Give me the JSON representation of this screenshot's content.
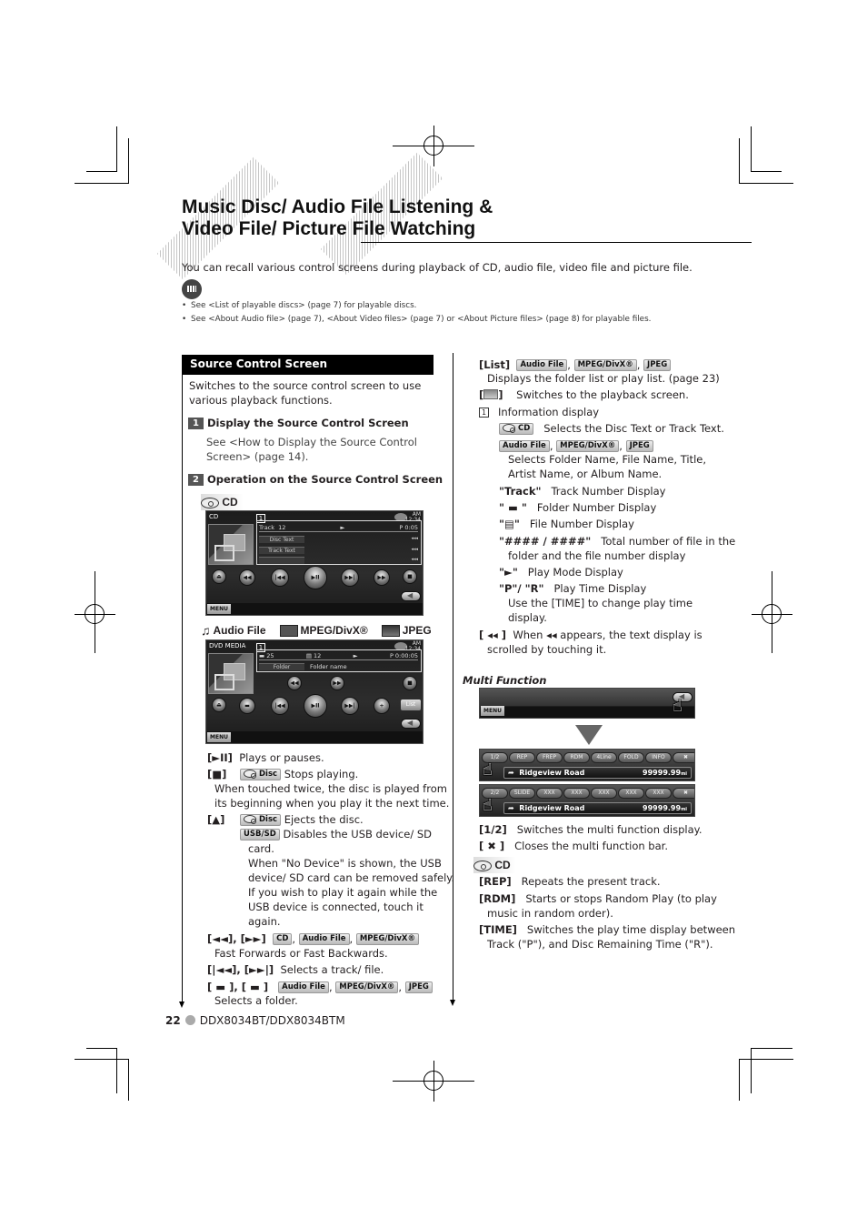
{
  "header": {
    "title_line1": "Music Disc/ Audio File Listening &",
    "title_line2": "Video File/ Picture File Watching",
    "intro": "You can recall various control screens during playback of CD, audio file, video file and picture file.",
    "notes": [
      "See <List of playable discs> (page 7) for playable discs.",
      "See <About Audio file> (page 7), <About Video files> (page 7) or <About Picture files> (page 8) for playable files."
    ]
  },
  "section": {
    "title": "Source Control Screen",
    "desc_line1": "Switches to the source control screen to use",
    "desc_line2": "various playback functions.",
    "step1": {
      "num": "1",
      "title": "Display the Source Control Screen",
      "line1": "See <How to Display the Source Control",
      "line2": "Screen> (page 14)."
    },
    "step2": {
      "num": "2",
      "title": "Operation on the Source Control Screen"
    }
  },
  "badges": {
    "cd": "CD",
    "audio_file": "Audio File",
    "mpeg_divx": "MPEG/DivX®",
    "jpeg": "JPEG",
    "disc": "Disc",
    "usb_sd": "USB/SD"
  },
  "cd_screen": {
    "source": "CD",
    "clock_ampm": "AM",
    "clock_time": "12:34",
    "info_num": "1",
    "track_label": "Track",
    "track_num": "12",
    "play_mode": "►",
    "time": "P  0:05",
    "disc_text": "Disc Text",
    "track_text": "Track Text",
    "scroll": "◂◂◂",
    "menu": "MENU",
    "buttons": [
      "⏏",
      "◀◀",
      "|◀◀",
      "▶II",
      "▶▶|",
      "▶▶",
      "■"
    ]
  },
  "media_screen": {
    "source": "DVD MEDIA",
    "clock_ampm": "AM",
    "clock_time": "12:34",
    "info_num": "1",
    "folder_num": "25",
    "file_num": "12",
    "play_mode": "►",
    "time": "P  0:00:05",
    "folder_label": "Folder",
    "folder_name": "Folder name",
    "list": "List",
    "menu": "MENU",
    "top_buttons": [
      "◀◀",
      "▶▶",
      "■"
    ],
    "buttons": [
      "⏏",
      "▬",
      "|◀◀",
      "▶II",
      "▶▶|",
      "+"
    ]
  },
  "left_desc": {
    "play_key": "[►II]",
    "play_text": "Plays or pauses.",
    "stop_key": "[■]",
    "stop_text": "Stops playing.",
    "stop_line2": "When touched twice, the disc is played from",
    "stop_line3": "its beginning when you play it the next time.",
    "eject_key": "[▲]",
    "eject_text": "Ejects the disc.",
    "usb_text": "Disables the USB device/ SD",
    "usb_lines": [
      "card.",
      "When \"No Device\" is shown, the USB",
      "device/ SD card can be removed safely.",
      "If you wish to play it again while the",
      "USB device is connected, touch it",
      "again."
    ],
    "ff_key": "[◄◄], [►►]",
    "ff_text": "Fast Forwards or Fast Backwards.",
    "skip_key": "[|◄◄], [►►|]",
    "skip_text": "Selects a track/ file.",
    "folder_key": "[ ▬ ], [ ▬ ]",
    "folder_text": "Selects a folder."
  },
  "right_desc": {
    "list_key": "[List]",
    "list_text": "Displays the folder list or play list. (page 23)",
    "switch_text": "Switches to the playback screen.",
    "info_num": "1",
    "info_title": "Information display",
    "cd_info": "Selects the Disc Text or Track Text.",
    "file_info_1": "Selects Folder Name, File Name, Title,",
    "file_info_2": "Artist Name, or Album Name.",
    "items": [
      {
        "key": "\"Track\"",
        "text": "Track Number Display"
      },
      {
        "key": "\" ▬ \"",
        "text": "Folder Number Display"
      },
      {
        "key": "\"▤\"",
        "text": "File Number Display"
      },
      {
        "key": "\"#### / ####\"",
        "text": "Total number of file in the"
      },
      {
        "key": "\"►\"",
        "text": "Play Mode Display"
      },
      {
        "key": "\"P\"/ \"R\"",
        "text": "Play Time Display"
      }
    ],
    "total_line2": "folder and the file number display",
    "time_line2": "Use the [TIME] to change play time",
    "time_line3": "display.",
    "scroll_key": "[ ◂◂ ]",
    "scroll_text": "When ◂◂ appears, the text display is",
    "scroll_line2": "scrolled by touching it."
  },
  "multi_function": {
    "heading": "Multi Function",
    "menu": "MENU",
    "row1": [
      "1/2",
      "REP",
      "FREP",
      "RDM",
      "4Line",
      "FOLD",
      "INFO",
      "✖"
    ],
    "row2": [
      "2/2",
      "SLIDE",
      "XXX",
      "XXX",
      "XXX",
      "XXX",
      "XXX",
      "✖"
    ],
    "road": "Ridgeview Road",
    "distance": "99999.99",
    "dist_unit": "mi",
    "desc": [
      {
        "key": "[1/2]",
        "text": "Switches the multi function display."
      },
      {
        "key": "[ ✖ ]",
        "text": "Closes the multi function bar."
      }
    ],
    "cd_items": [
      {
        "key": "[REP]",
        "text": "Repeats the present track."
      },
      {
        "key": "[RDM]",
        "text": "Starts or stops Random Play (to play"
      },
      {
        "key": "[TIME]",
        "text": "Switches the play time display between"
      }
    ],
    "rdm_line2": "music in random order).",
    "time_line2": "Track (\"P\"), and Disc Remaining Time (\"R\")."
  },
  "footer": {
    "page": "22",
    "model": "DDX8034BT/DDX8034BTM"
  }
}
